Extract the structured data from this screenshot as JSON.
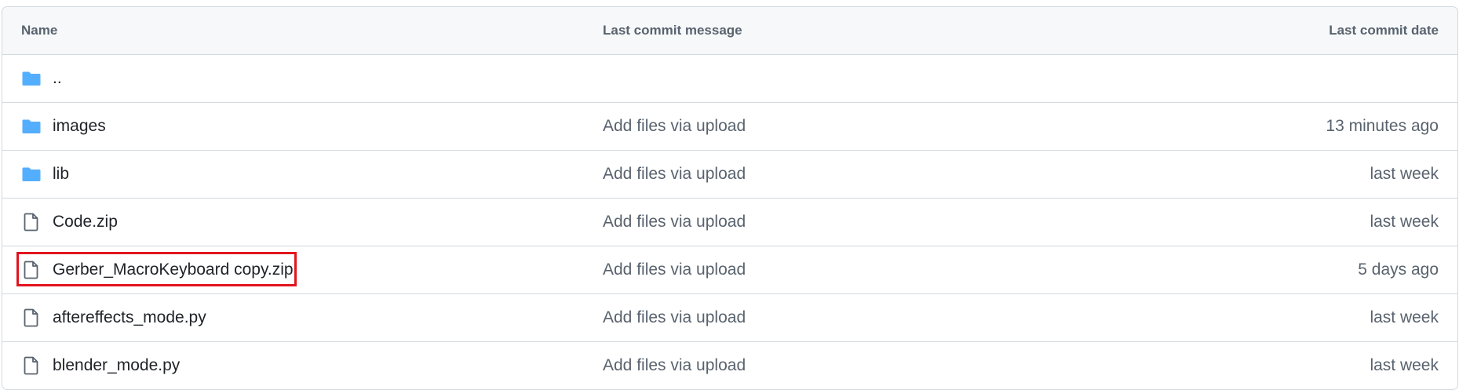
{
  "header": {
    "name": "Name",
    "message": "Last commit message",
    "date": "Last commit date"
  },
  "rows": [
    {
      "icon": "folder-icon",
      "name": "..",
      "message": "",
      "date": ""
    },
    {
      "icon": "folder-icon",
      "name": "images",
      "message": "Add files via upload",
      "date": "13 minutes ago"
    },
    {
      "icon": "folder-icon",
      "name": "lib",
      "message": "Add files via upload",
      "date": "last week"
    },
    {
      "icon": "file-icon",
      "name": "Code.zip",
      "message": "Add files via upload",
      "date": "last week"
    },
    {
      "icon": "file-icon",
      "name": "Gerber_MacroKeyboard copy.zip",
      "message": "Add files via upload",
      "date": "5 days ago"
    },
    {
      "icon": "file-icon",
      "name": "aftereffects_mode.py",
      "message": "Add files via upload",
      "date": "last week"
    },
    {
      "icon": "file-icon",
      "name": "blender_mode.py",
      "message": "Add files via upload",
      "date": "last week"
    }
  ],
  "colors": {
    "folder": "#54aeff",
    "file": "#59636e",
    "highlight": "#e3141e",
    "border": "#d1d9e0",
    "header_bg": "#f6f8fa"
  }
}
